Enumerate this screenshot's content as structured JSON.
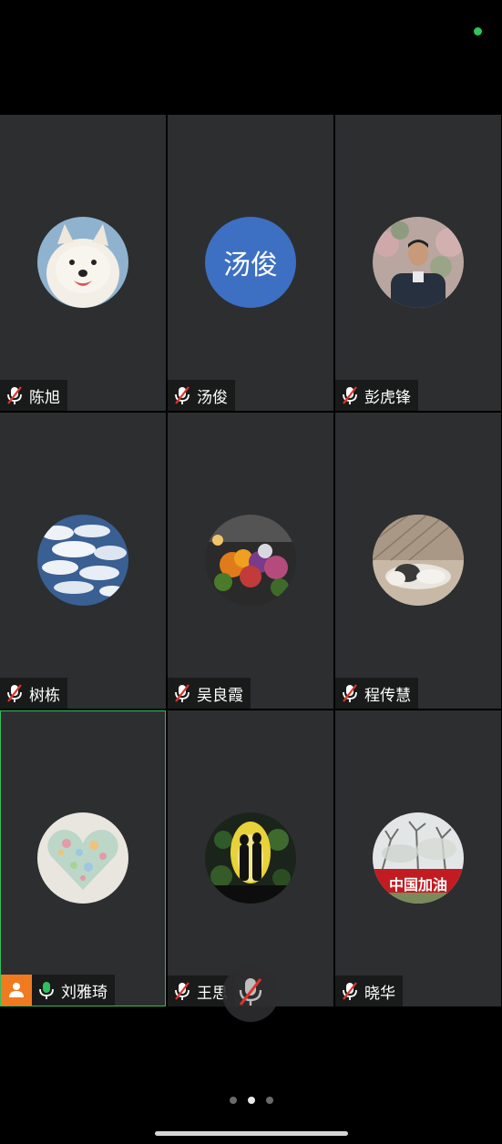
{
  "participants": [
    {
      "name": "陈旭",
      "avatar": "samoyed-dog-photo",
      "mic": "muted"
    },
    {
      "name": "汤俊",
      "avatar_text": "汤俊",
      "avatar_color": "#3d6fc3",
      "mic": "muted"
    },
    {
      "name": "彭虎锋",
      "avatar": "man-portrait-photo",
      "mic": "muted"
    },
    {
      "name": "树栋",
      "avatar": "clouds-aerial-photo",
      "mic": "muted"
    },
    {
      "name": "吴良霞",
      "avatar": "flowers-photo",
      "mic": "muted"
    },
    {
      "name": "程传慧",
      "avatar": "cat-photo",
      "mic": "muted"
    },
    {
      "name": "刘雅琦",
      "avatar": "floral-heart-art",
      "mic": "unmuted",
      "host": true,
      "active_speaker": true
    },
    {
      "name": "王思",
      "avatar": "couple-silhouette-photo",
      "mic": "muted"
    },
    {
      "name": "晓华",
      "avatar": "china-jiayou-photo",
      "avatar_caption": "中国加油",
      "mic": "muted"
    }
  ],
  "controls": {
    "floating_mic": "mic-muted-icon"
  },
  "pagination": {
    "total": 3,
    "current": 2
  },
  "colors": {
    "tile_bg": "#2c2e30",
    "active_border": "#2fbf5f",
    "status_dot": "#2ec45a",
    "host_badge": "#f07a20",
    "mute_red": "#e0342c"
  }
}
